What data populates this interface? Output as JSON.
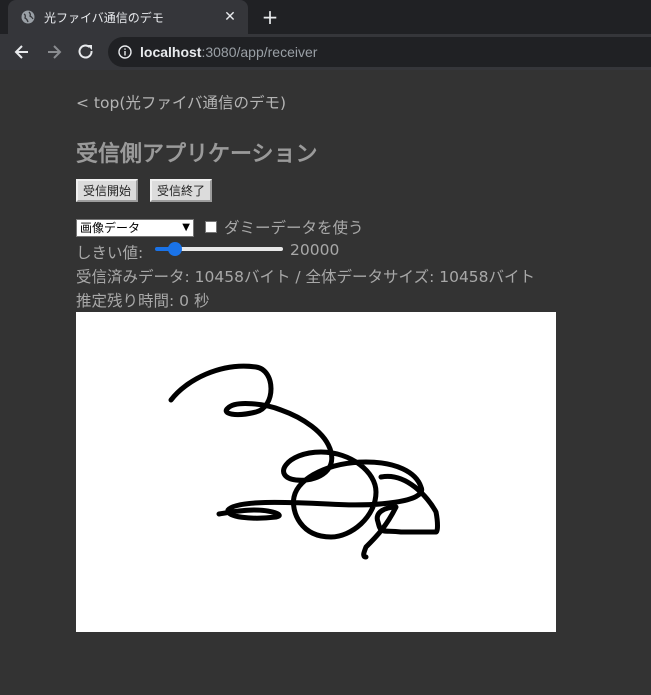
{
  "browser": {
    "tab_title": "光ファイバ通信のデモ",
    "tab_close": "✕",
    "new_tab": "+",
    "url_host": "localhost",
    "url_path": ":3080/app/receiver"
  },
  "page": {
    "back_link": "< top(光ファイバ通信のデモ)",
    "title": "受信側アプリケーション",
    "start_button": "受信開始",
    "stop_button": "受信終了",
    "select_value": "画像データ",
    "dummy_label": "ダミーデータを使う",
    "threshold_label": "しきい値:",
    "threshold_value": "20000",
    "received_info": "受信済みデータ: 10458バイト / 全体データサイズ: 10458バイト",
    "remaining_time": "推定残り時間: 0 秒"
  },
  "colors": {
    "page_bg": "#333333",
    "text": "#a8a8a8",
    "accent": "#1a73e8"
  }
}
